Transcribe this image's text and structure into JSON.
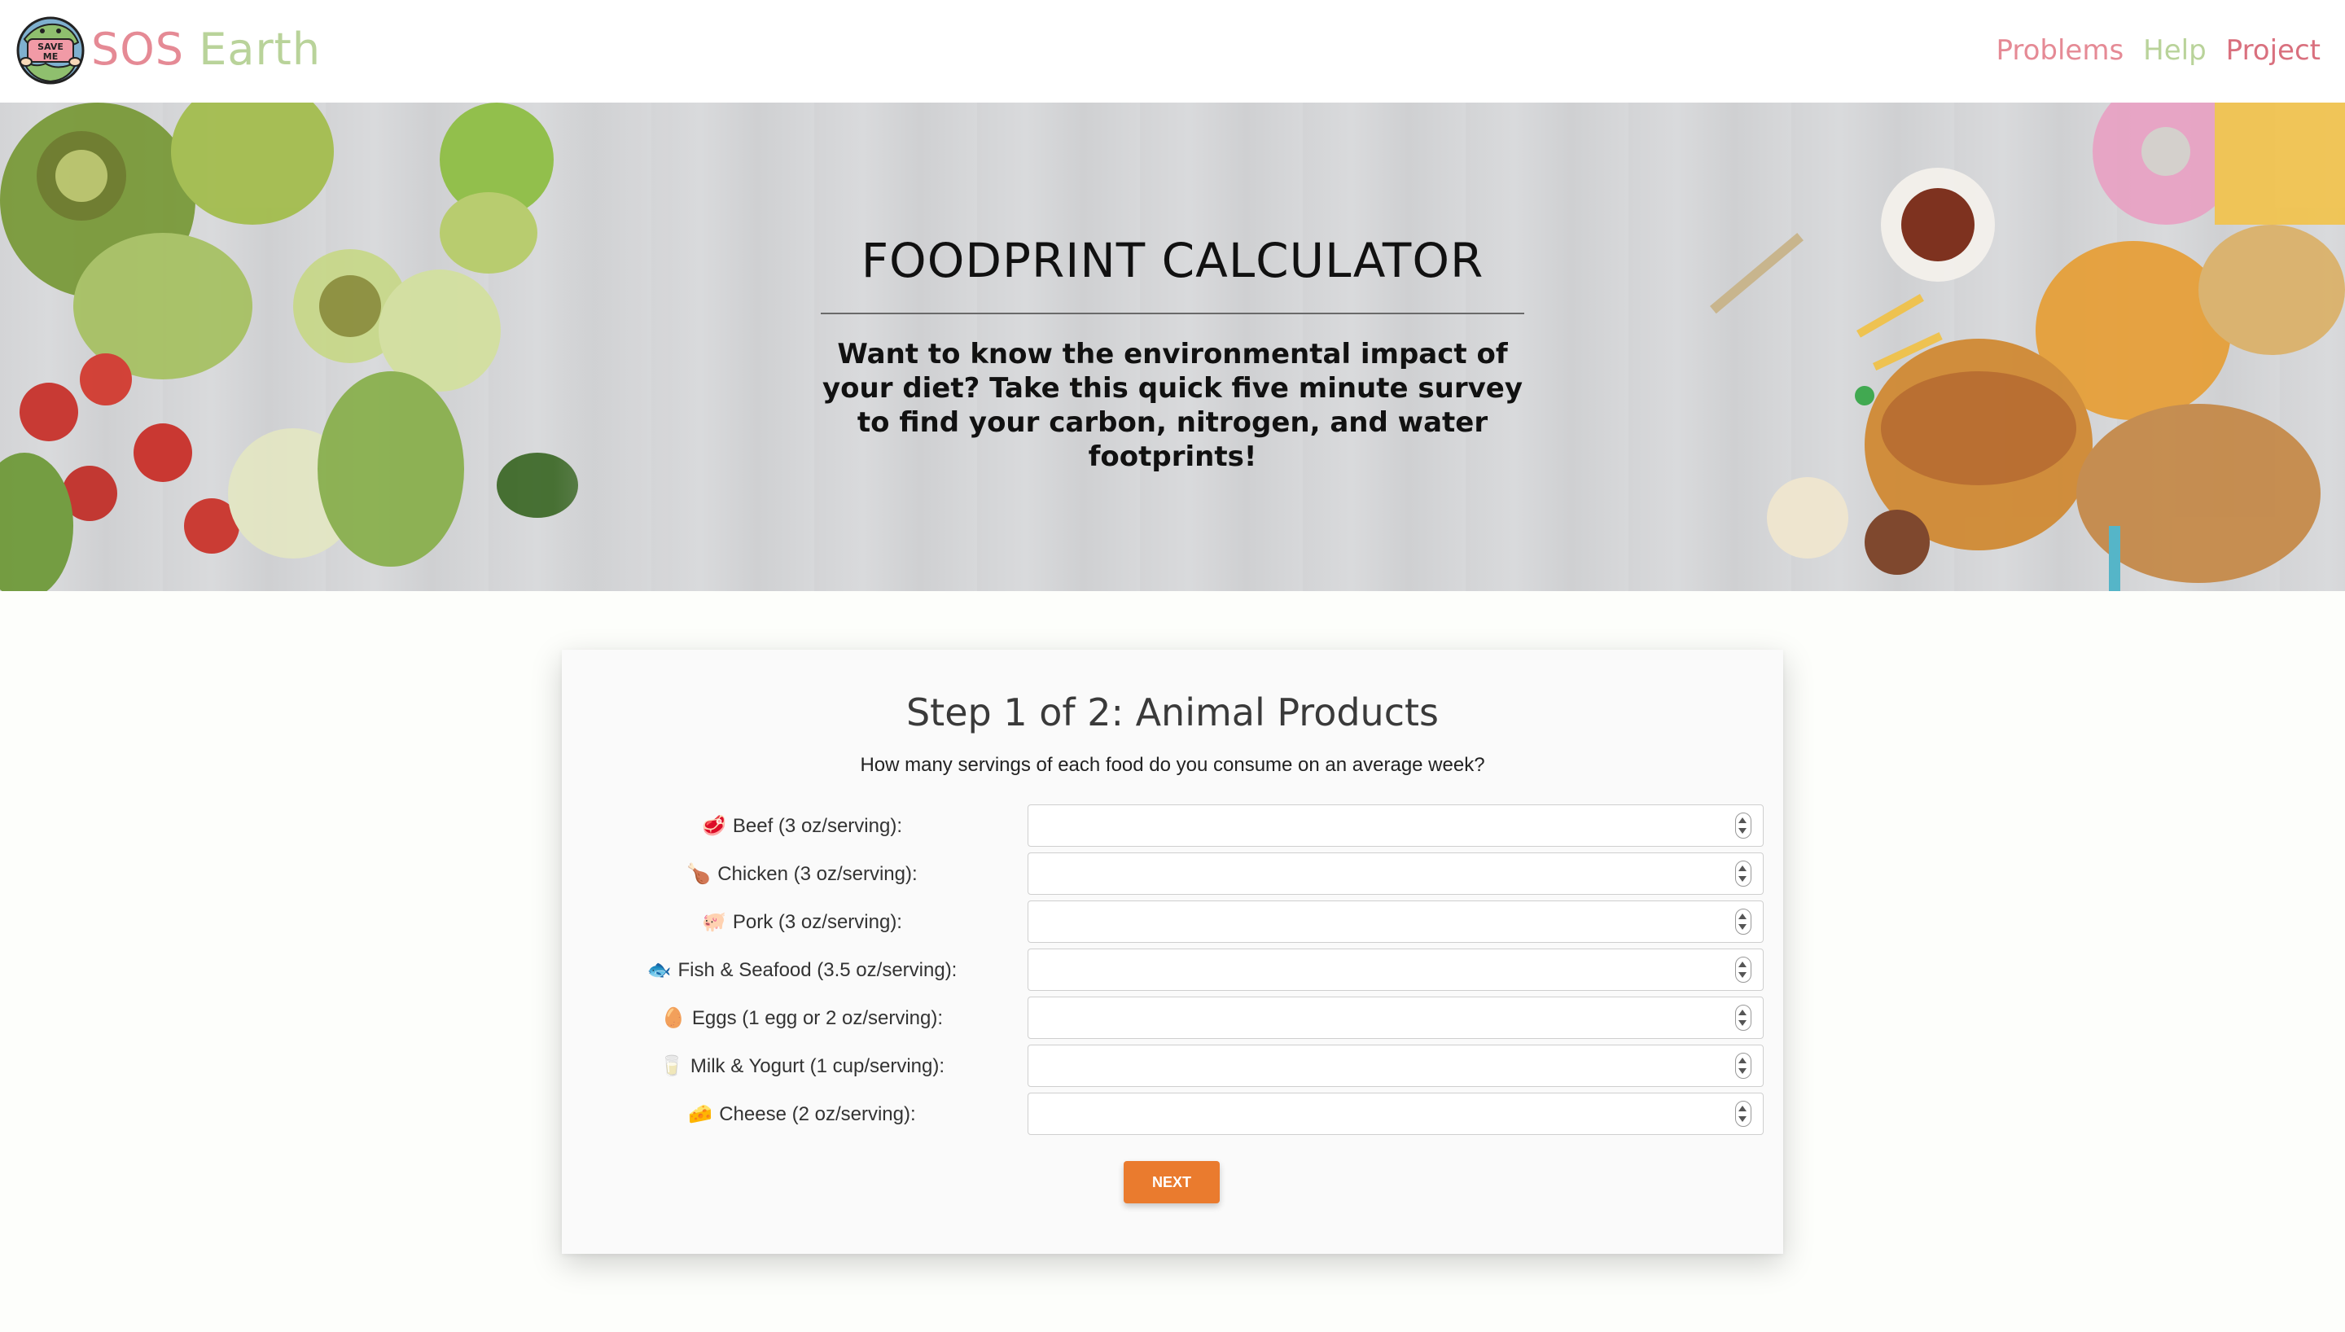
{
  "brand": {
    "sos": "SOS",
    "earth": "Earth",
    "logo_text_top": "SAVE",
    "logo_text_bottom": "ME"
  },
  "nav": {
    "problems": "Problems",
    "help": "Help",
    "project": "Project"
  },
  "hero": {
    "title": "FOODPRINT CALCULATOR",
    "description": "Want to know the environmental impact of your diet? Take this quick five minute survey to find your carbon, nitrogen, and water footprints!"
  },
  "form": {
    "title": "Step 1 of 2: Animal Products",
    "subtitle": "How many servings of each food do you consume on an average week?",
    "fields": [
      {
        "emoji": "🥩",
        "label": "Beef (3 oz/serving):",
        "value": ""
      },
      {
        "emoji": "🍗",
        "label": "Chicken (3 oz/serving):",
        "value": ""
      },
      {
        "emoji": "🐖",
        "label": "Pork (3 oz/serving):",
        "value": ""
      },
      {
        "emoji": "🐟",
        "label": "Fish & Seafood (3.5 oz/serving):",
        "value": ""
      },
      {
        "emoji": "🥚",
        "label": "Eggs (1 egg or 2 oz/serving):",
        "value": ""
      },
      {
        "emoji": "🥛",
        "label": "Milk & Yogurt (1 cup/serving):",
        "value": ""
      },
      {
        "emoji": "🧀",
        "label": "Cheese (2 oz/serving):",
        "value": ""
      }
    ],
    "next_label": "NEXT"
  },
  "colors": {
    "brand_pink": "#e58a95",
    "brand_green": "#b9d39a",
    "accent_orange": "#ea7b2e"
  }
}
